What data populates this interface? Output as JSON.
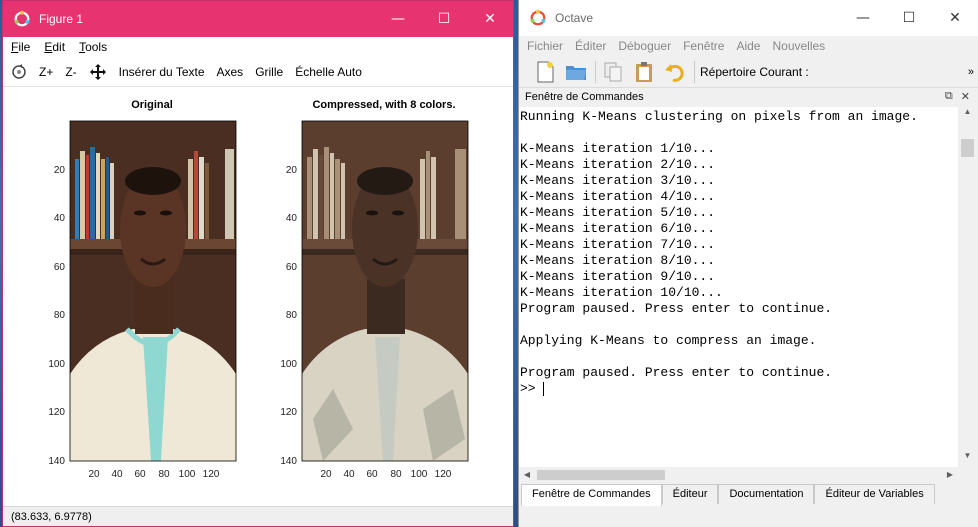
{
  "figure": {
    "title": "Figure 1",
    "menus": [
      {
        "mnemonic": "F",
        "rest": "ile"
      },
      {
        "mnemonic": "E",
        "rest": "dit"
      },
      {
        "mnemonic": "T",
        "rest": "ools"
      }
    ],
    "toolbar": {
      "zoom_in": "Z+",
      "zoom_out": "Z-",
      "insert_text": "Insérer du Texte",
      "axes": "Axes",
      "grid": "Grille",
      "autoscale": "Échelle Auto"
    },
    "status": "(83.633, 6.9778)",
    "plots": [
      {
        "title": "Original"
      },
      {
        "title": "Compressed, with 8 colors."
      }
    ],
    "axes": {
      "y_ticks": [
        "20",
        "40",
        "60",
        "80",
        "100",
        "120",
        "140"
      ],
      "x_ticks": [
        "20",
        "40",
        "60",
        "80",
        "100",
        "120"
      ]
    }
  },
  "octave": {
    "title": "Octave",
    "menus": [
      "Fichier",
      "Éditer",
      "Déboguer",
      "Fenêtre",
      "Aide",
      "Nouvelles"
    ],
    "current_dir_label": "Répertoire Courant :",
    "dock_title": "Fenêtre de Commandes",
    "console_lines": [
      "Running K-Means clustering on pixels from an image.",
      "",
      "K-Means iteration 1/10...",
      "K-Means iteration 2/10...",
      "K-Means iteration 3/10...",
      "K-Means iteration 4/10...",
      "K-Means iteration 5/10...",
      "K-Means iteration 6/10...",
      "K-Means iteration 7/10...",
      "K-Means iteration 8/10...",
      "K-Means iteration 9/10...",
      "K-Means iteration 10/10...",
      "Program paused. Press enter to continue.",
      "",
      "Applying K-Means to compress an image.",
      "",
      "Program paused. Press enter to continue."
    ],
    "prompt": ">> ",
    "tabs": [
      "Fenêtre de Commandes",
      "Éditeur",
      "Documentation",
      "Éditeur de Variables"
    ]
  },
  "colors": {
    "figure_titlebar": "#e7336f",
    "desktop": "#2c5a9e"
  }
}
